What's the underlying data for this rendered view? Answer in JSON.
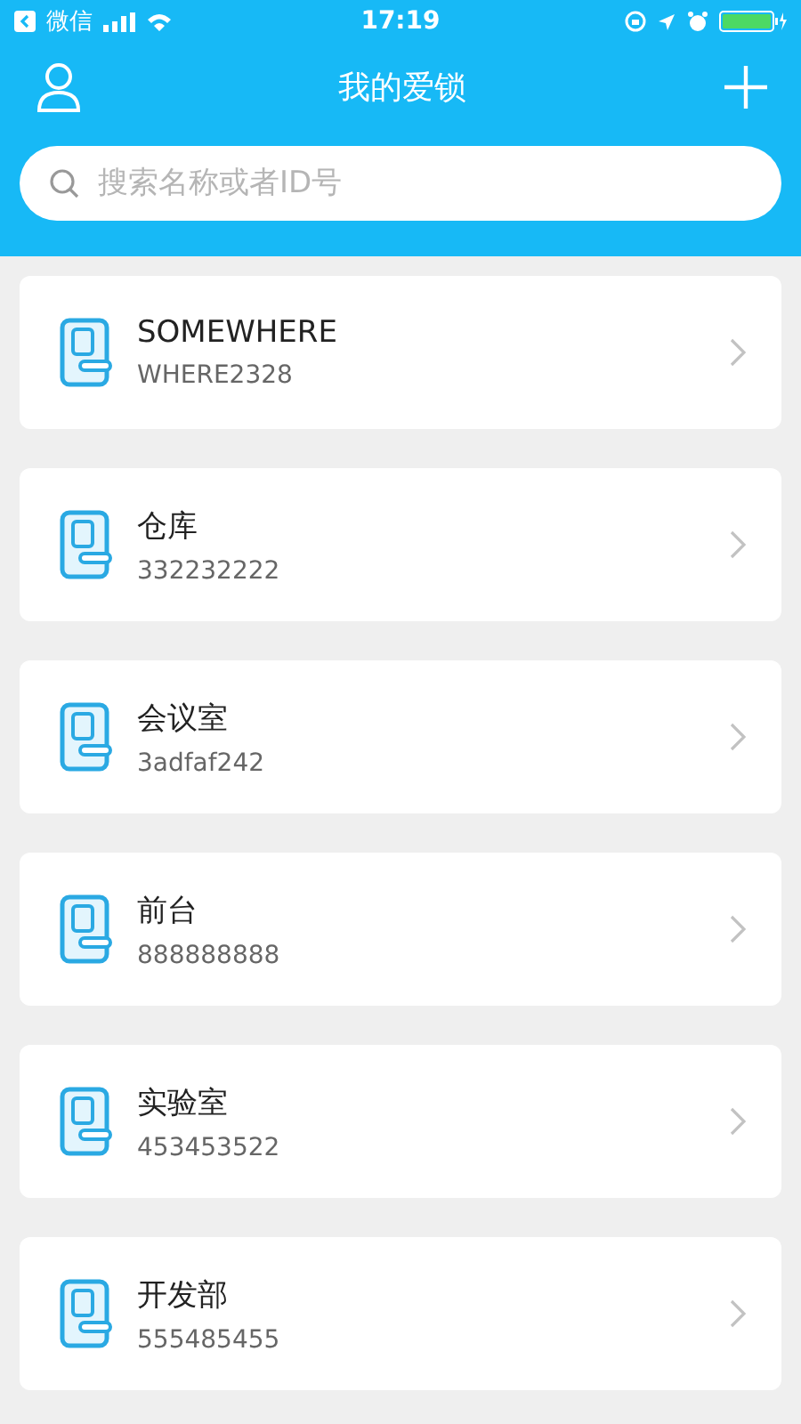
{
  "status_bar": {
    "back_app": "微信",
    "time": "17:19"
  },
  "header": {
    "title": "我的爱锁"
  },
  "search": {
    "placeholder": "搜索名称或者ID号"
  },
  "locks": [
    {
      "name": "SOMEWHERE",
      "id": "WHERE2328"
    },
    {
      "name": "仓库",
      "id": "332232222"
    },
    {
      "name": "会议室",
      "id": "3adfaf242"
    },
    {
      "name": "前台",
      "id": "888888888"
    },
    {
      "name": "实验室",
      "id": "453453522"
    },
    {
      "name": "开发部",
      "id": "555485455"
    }
  ]
}
